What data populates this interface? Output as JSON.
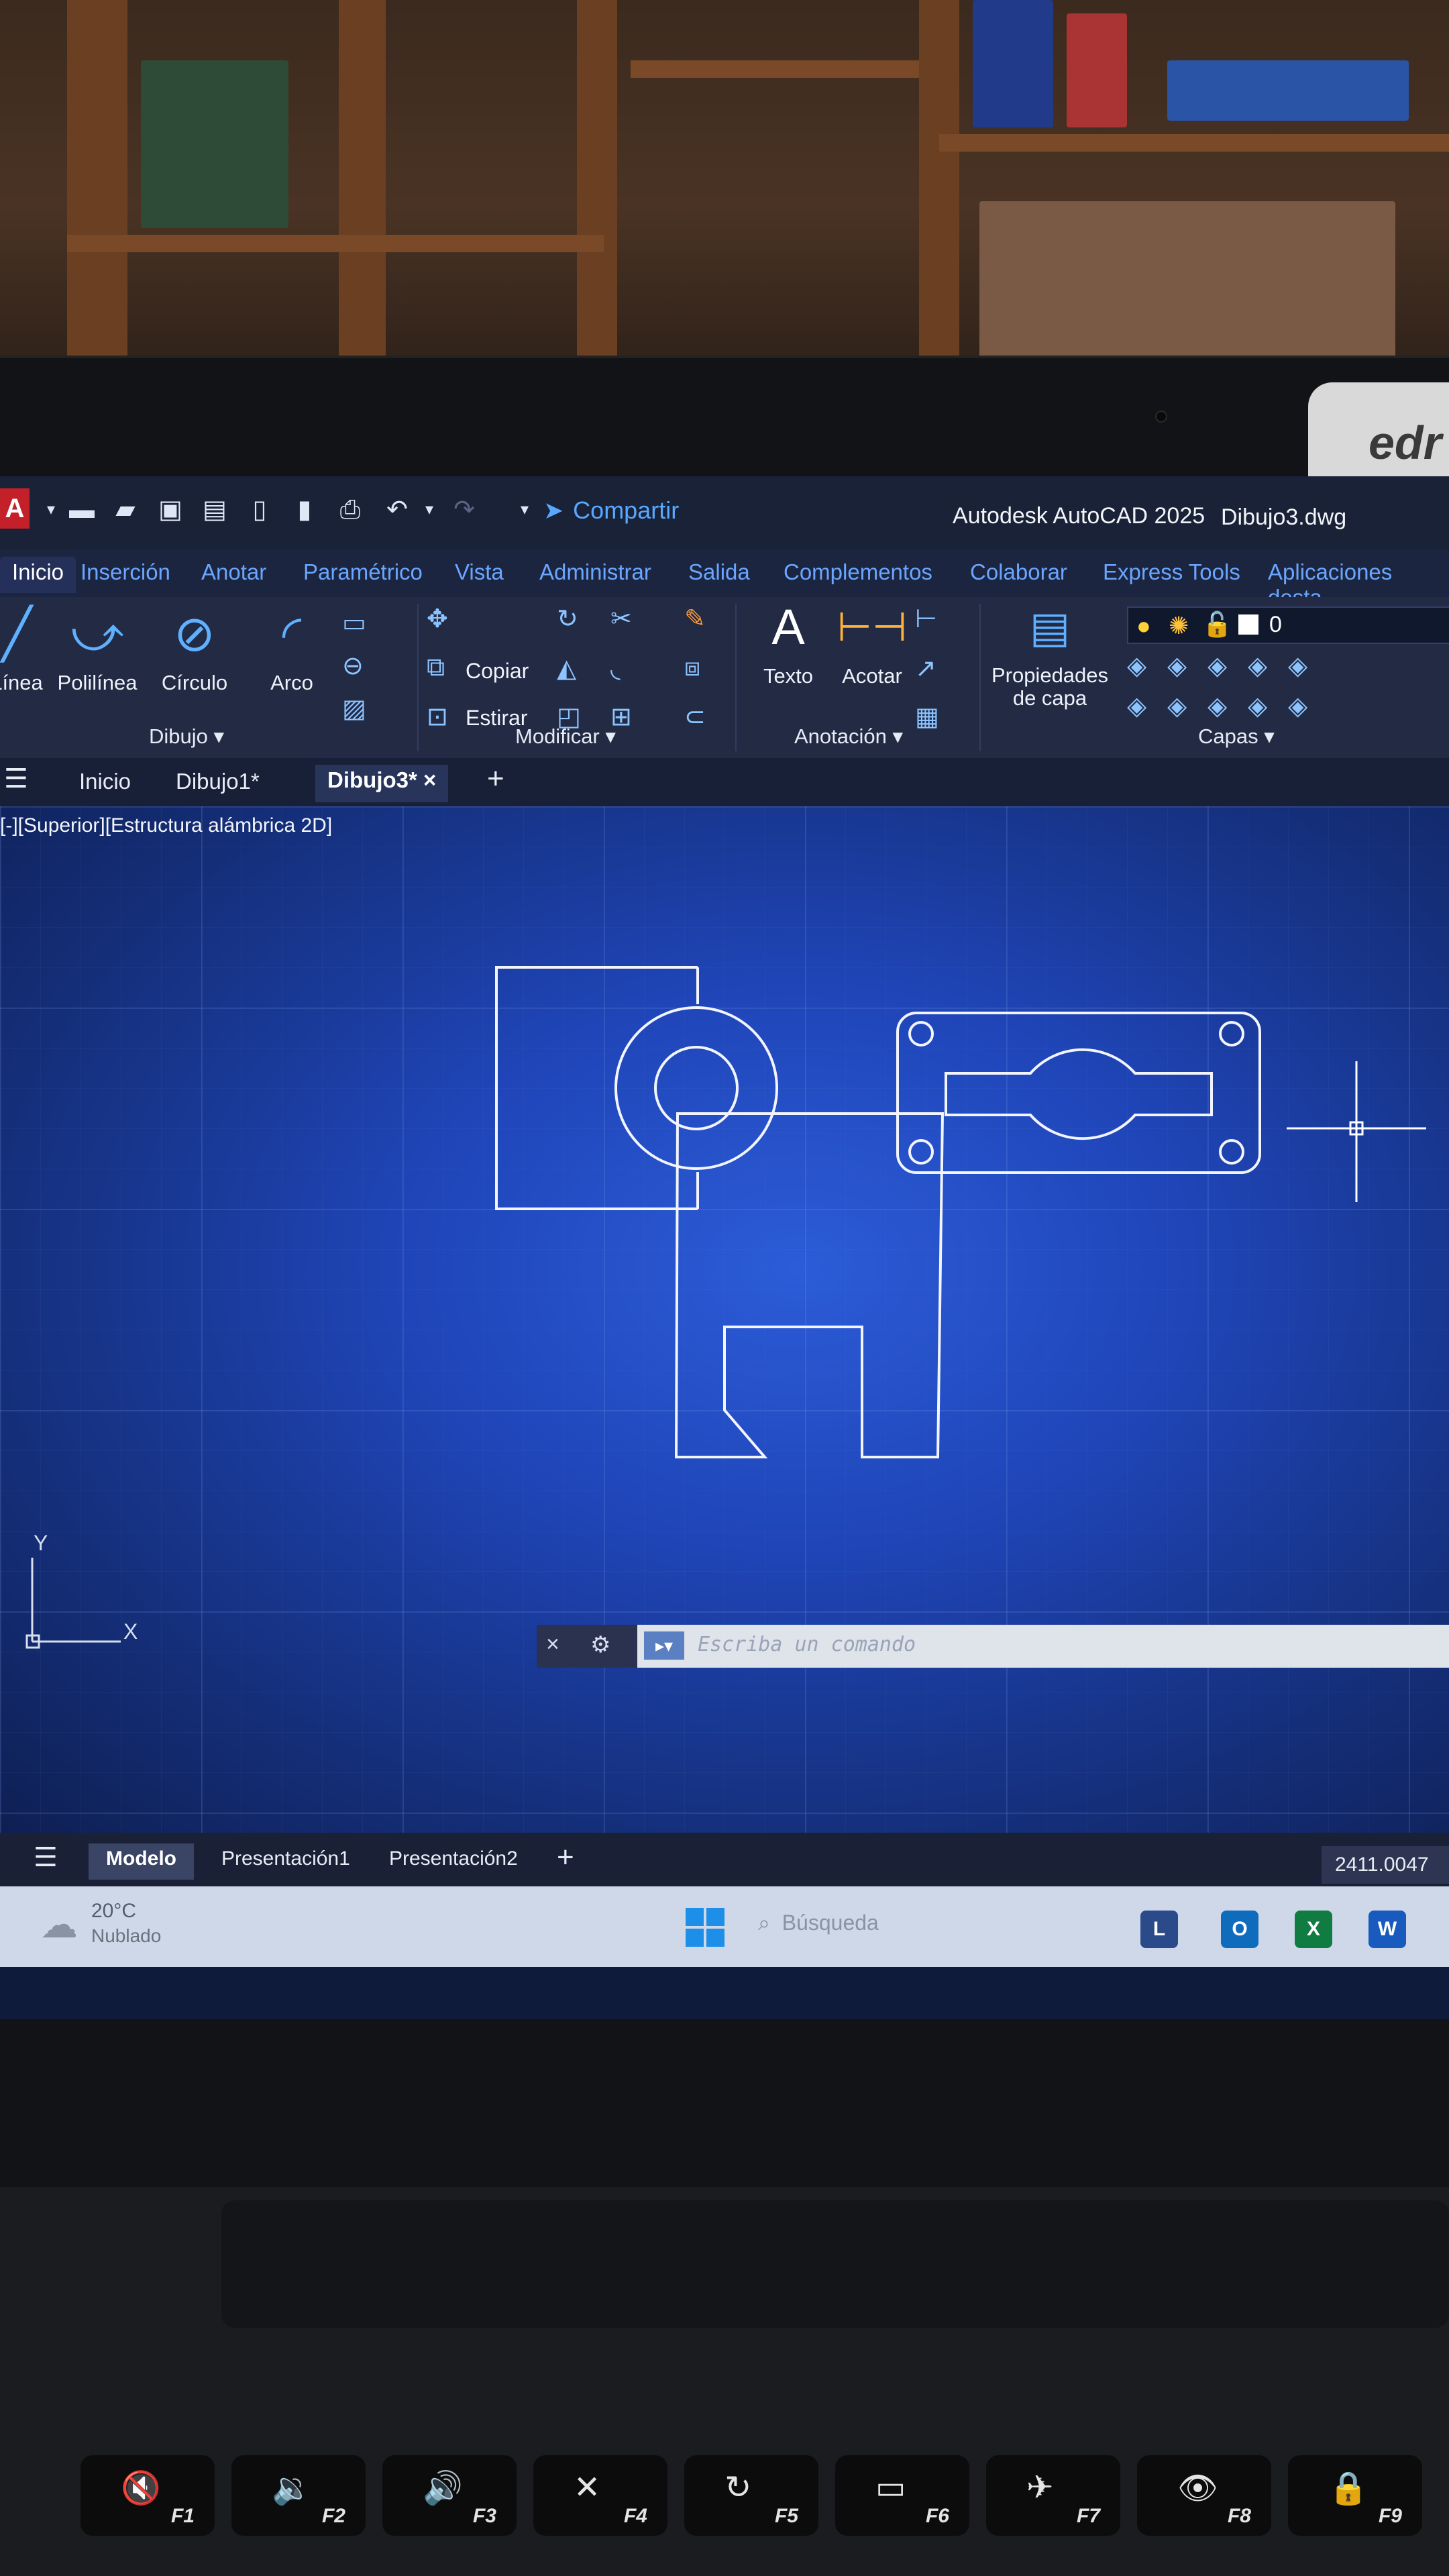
{
  "titlebar": {
    "logo": "A",
    "share_label": "Compartir",
    "app_title": "Autodesk AutoCAD 2025",
    "file_title": "Dibujo3.dwg",
    "icons": [
      "new-icon",
      "open-icon",
      "save-icon",
      "save-as-icon",
      "open-web-icon",
      "save-web-icon",
      "print-icon",
      "undo-icon",
      "redo-icon"
    ]
  },
  "ribbon_tabs": [
    "Inicio",
    "Inserción",
    "Anotar",
    "Paramétrico",
    "Vista",
    "Administrar",
    "Salida",
    "Complementos",
    "Colaborar",
    "Express Tools",
    "Aplicaciones desta"
  ],
  "ribbon": {
    "dibujo": {
      "title": "Dibujo",
      "buttons": [
        "Línea",
        "Polilínea",
        "Círculo",
        "Arco"
      ]
    },
    "modificar": {
      "title": "Modificar",
      "copiar": "Copiar",
      "estirar": "Estirar"
    },
    "anotacion": {
      "title": "Anotación",
      "texto": "Texto",
      "acotar": "Acotar"
    },
    "capas": {
      "title": "Capas",
      "propiedades": "Propiedades\nde capa",
      "current_layer": "0"
    }
  },
  "file_tabs": {
    "inicio": "Inicio",
    "dibujo1": "Dibujo1*",
    "dibujo3": "Dibujo3*",
    "close": "×",
    "add": "+"
  },
  "viewport_label": "[-][Superior][Estructura alámbrica 2D]",
  "ucs": {
    "x": "X",
    "y": "Y"
  },
  "command_line": {
    "placeholder": "Escriba un comando",
    "close": "×",
    "options": "⚙"
  },
  "layout_tabs": {
    "modelo": "Modelo",
    "presentacion1": "Presentación1",
    "presentacion2": "Presentación2",
    "add": "+"
  },
  "coordinates": "2411.0047",
  "taskbar": {
    "weather_temp": "20°C",
    "weather_desc": "Nublado",
    "search": "Búsqueda",
    "apps": [
      "L",
      "O",
      "X",
      "W"
    ]
  },
  "keys": [
    {
      "sym": "🔇",
      "fn": "F1"
    },
    {
      "sym": "🔉",
      "fn": "F2"
    },
    {
      "sym": "🔊",
      "fn": "F3"
    },
    {
      "sym": "✕",
      "fn": "F4"
    },
    {
      "sym": "↻",
      "fn": "F5"
    },
    {
      "sym": "▭",
      "fn": "F6"
    },
    {
      "sym": "✈",
      "fn": "F7"
    },
    {
      "sym": "👁",
      "fn": "F8"
    },
    {
      "sym": "🔒",
      "fn": "F9"
    }
  ],
  "brand": "edr",
  "colors": {
    "accent": "#58a8ff",
    "canvas": "#1f45b8",
    "autocad_red": "#c4202a"
  }
}
